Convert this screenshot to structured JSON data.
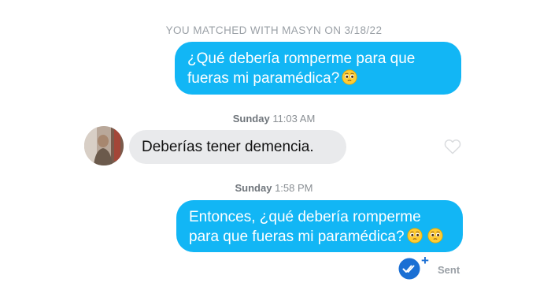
{
  "match_header": "YOU MATCHED WITH MASYN ON 3/18/22",
  "messages": [
    {
      "direction": "outgoing",
      "text": "¿Qué debería romperme para que fueras mi paramédica?",
      "emoji": [
        "pleading-face"
      ]
    },
    {
      "timestamp": {
        "day": "Sunday",
        "time": "11:03 AM"
      }
    },
    {
      "direction": "incoming",
      "text": "Deberías tener demencia.",
      "liked": false
    },
    {
      "timestamp": {
        "day": "Sunday",
        "time": "1:58 PM"
      }
    },
    {
      "direction": "outgoing",
      "text": "Entonces, ¿qué debería romperme para que fueras mi paramédica?",
      "emoji": [
        "pleading-face",
        "pleading-face"
      ]
    }
  ],
  "status": {
    "label": "Sent",
    "icon": "double-check-icon",
    "badge": "+"
  },
  "colors": {
    "outgoing_bubble": "#12b6f5",
    "incoming_bubble": "#e9eaec",
    "status_badge": "#1a6fd4",
    "muted_text": "#9aa0a6"
  }
}
